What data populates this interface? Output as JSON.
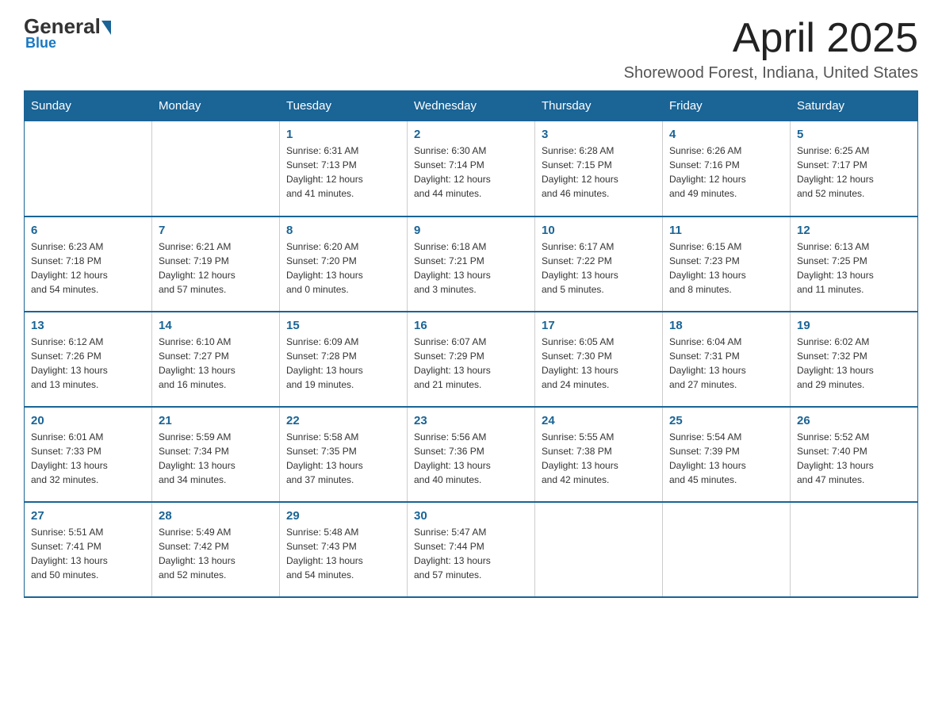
{
  "header": {
    "logo_general": "General",
    "logo_blue": "Blue",
    "month_title": "April 2025",
    "location": "Shorewood Forest, Indiana, United States"
  },
  "weekdays": [
    "Sunday",
    "Monday",
    "Tuesday",
    "Wednesday",
    "Thursday",
    "Friday",
    "Saturday"
  ],
  "weeks": [
    [
      {
        "day": "",
        "info": ""
      },
      {
        "day": "",
        "info": ""
      },
      {
        "day": "1",
        "info": "Sunrise: 6:31 AM\nSunset: 7:13 PM\nDaylight: 12 hours\nand 41 minutes."
      },
      {
        "day": "2",
        "info": "Sunrise: 6:30 AM\nSunset: 7:14 PM\nDaylight: 12 hours\nand 44 minutes."
      },
      {
        "day": "3",
        "info": "Sunrise: 6:28 AM\nSunset: 7:15 PM\nDaylight: 12 hours\nand 46 minutes."
      },
      {
        "day": "4",
        "info": "Sunrise: 6:26 AM\nSunset: 7:16 PM\nDaylight: 12 hours\nand 49 minutes."
      },
      {
        "day": "5",
        "info": "Sunrise: 6:25 AM\nSunset: 7:17 PM\nDaylight: 12 hours\nand 52 minutes."
      }
    ],
    [
      {
        "day": "6",
        "info": "Sunrise: 6:23 AM\nSunset: 7:18 PM\nDaylight: 12 hours\nand 54 minutes."
      },
      {
        "day": "7",
        "info": "Sunrise: 6:21 AM\nSunset: 7:19 PM\nDaylight: 12 hours\nand 57 minutes."
      },
      {
        "day": "8",
        "info": "Sunrise: 6:20 AM\nSunset: 7:20 PM\nDaylight: 13 hours\nand 0 minutes."
      },
      {
        "day": "9",
        "info": "Sunrise: 6:18 AM\nSunset: 7:21 PM\nDaylight: 13 hours\nand 3 minutes."
      },
      {
        "day": "10",
        "info": "Sunrise: 6:17 AM\nSunset: 7:22 PM\nDaylight: 13 hours\nand 5 minutes."
      },
      {
        "day": "11",
        "info": "Sunrise: 6:15 AM\nSunset: 7:23 PM\nDaylight: 13 hours\nand 8 minutes."
      },
      {
        "day": "12",
        "info": "Sunrise: 6:13 AM\nSunset: 7:25 PM\nDaylight: 13 hours\nand 11 minutes."
      }
    ],
    [
      {
        "day": "13",
        "info": "Sunrise: 6:12 AM\nSunset: 7:26 PM\nDaylight: 13 hours\nand 13 minutes."
      },
      {
        "day": "14",
        "info": "Sunrise: 6:10 AM\nSunset: 7:27 PM\nDaylight: 13 hours\nand 16 minutes."
      },
      {
        "day": "15",
        "info": "Sunrise: 6:09 AM\nSunset: 7:28 PM\nDaylight: 13 hours\nand 19 minutes."
      },
      {
        "day": "16",
        "info": "Sunrise: 6:07 AM\nSunset: 7:29 PM\nDaylight: 13 hours\nand 21 minutes."
      },
      {
        "day": "17",
        "info": "Sunrise: 6:05 AM\nSunset: 7:30 PM\nDaylight: 13 hours\nand 24 minutes."
      },
      {
        "day": "18",
        "info": "Sunrise: 6:04 AM\nSunset: 7:31 PM\nDaylight: 13 hours\nand 27 minutes."
      },
      {
        "day": "19",
        "info": "Sunrise: 6:02 AM\nSunset: 7:32 PM\nDaylight: 13 hours\nand 29 minutes."
      }
    ],
    [
      {
        "day": "20",
        "info": "Sunrise: 6:01 AM\nSunset: 7:33 PM\nDaylight: 13 hours\nand 32 minutes."
      },
      {
        "day": "21",
        "info": "Sunrise: 5:59 AM\nSunset: 7:34 PM\nDaylight: 13 hours\nand 34 minutes."
      },
      {
        "day": "22",
        "info": "Sunrise: 5:58 AM\nSunset: 7:35 PM\nDaylight: 13 hours\nand 37 minutes."
      },
      {
        "day": "23",
        "info": "Sunrise: 5:56 AM\nSunset: 7:36 PM\nDaylight: 13 hours\nand 40 minutes."
      },
      {
        "day": "24",
        "info": "Sunrise: 5:55 AM\nSunset: 7:38 PM\nDaylight: 13 hours\nand 42 minutes."
      },
      {
        "day": "25",
        "info": "Sunrise: 5:54 AM\nSunset: 7:39 PM\nDaylight: 13 hours\nand 45 minutes."
      },
      {
        "day": "26",
        "info": "Sunrise: 5:52 AM\nSunset: 7:40 PM\nDaylight: 13 hours\nand 47 minutes."
      }
    ],
    [
      {
        "day": "27",
        "info": "Sunrise: 5:51 AM\nSunset: 7:41 PM\nDaylight: 13 hours\nand 50 minutes."
      },
      {
        "day": "28",
        "info": "Sunrise: 5:49 AM\nSunset: 7:42 PM\nDaylight: 13 hours\nand 52 minutes."
      },
      {
        "day": "29",
        "info": "Sunrise: 5:48 AM\nSunset: 7:43 PM\nDaylight: 13 hours\nand 54 minutes."
      },
      {
        "day": "30",
        "info": "Sunrise: 5:47 AM\nSunset: 7:44 PM\nDaylight: 13 hours\nand 57 minutes."
      },
      {
        "day": "",
        "info": ""
      },
      {
        "day": "",
        "info": ""
      },
      {
        "day": "",
        "info": ""
      }
    ]
  ]
}
